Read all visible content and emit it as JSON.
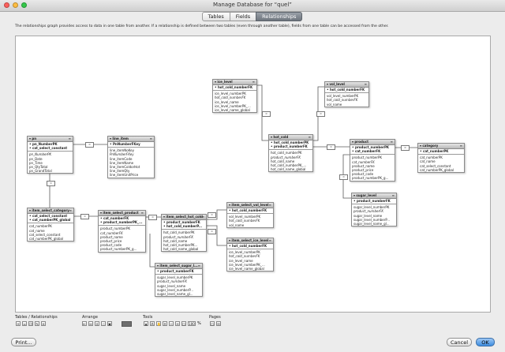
{
  "window": {
    "title": "Manage Database for “quel”"
  },
  "tabs": [
    {
      "label": "Tables"
    },
    {
      "label": "Fields"
    },
    {
      "label": "Relationships"
    }
  ],
  "description": "The relationships graph provides access to data in one table from another. If a relationship is defined between two tables (even through another table), fields from one table can be accessed from the other.",
  "tables": {
    "pn": {
      "name": "pn",
      "rows": [
        {
          "t": "pn_NumberPK",
          "c": "key"
        },
        {
          "t": "cat_select_constant",
          "c": "key"
        },
        {
          "sep": true
        },
        {
          "t": "pn_NumberPK",
          "c": "fk"
        },
        {
          "t": "pn_Date"
        },
        {
          "t": "pn_Time"
        },
        {
          "t": "pn_QtyTotal"
        },
        {
          "t": "pn_GrandTotal"
        }
      ]
    },
    "line_item": {
      "name": "line_item",
      "rows": [
        {
          "t": "PnNumberFKey",
          "c": "key"
        },
        {
          "sep": true
        },
        {
          "t": "line_itemNoKey"
        },
        {
          "t": "PnNumberFKey",
          "c": "fk"
        },
        {
          "t": "line_itemCode"
        },
        {
          "t": "line_itemName"
        },
        {
          "t": "line_itemColdorHot"
        },
        {
          "t": "line_itemQty"
        },
        {
          "t": "line_itemUnitPrice"
        }
      ]
    },
    "ice_level": {
      "name": "ice_level",
      "rows": [
        {
          "t": "hot_cold_numberFK",
          "c": "key"
        },
        {
          "sep": true
        },
        {
          "t": "ice_level_numberPK"
        },
        {
          "t": "hot_cold_numberFK",
          "c": "fk"
        },
        {
          "t": "ice_level_name"
        },
        {
          "t": "ice_level_numberPK_..."
        },
        {
          "t": "ice_level_name_global"
        }
      ]
    },
    "vol_level": {
      "name": "vol_level",
      "rows": [
        {
          "t": "hot_cold_numberFK",
          "c": "key"
        },
        {
          "sep": true
        },
        {
          "t": "vol_level_numberPK"
        },
        {
          "t": "hot_cold_numberFK",
          "c": "fk"
        },
        {
          "t": "vol_name"
        }
      ]
    },
    "hot_cold": {
      "name": "hot_cold",
      "rows": [
        {
          "t": "hot_cold_numberPK",
          "c": "key"
        },
        {
          "t": "product_numberFK",
          "c": "key"
        },
        {
          "sep": true
        },
        {
          "t": "hot_cold_numberPK"
        },
        {
          "t": "product_numberFK",
          "c": "fk"
        },
        {
          "t": "hot_cold_name"
        },
        {
          "t": "hot_cold_numberPK_..."
        },
        {
          "t": "hot_cold_name_global"
        }
      ]
    },
    "product": {
      "name": "product",
      "rows": [
        {
          "t": "product_numberPK",
          "c": "key"
        },
        {
          "t": "cat_numberFK",
          "c": "key"
        },
        {
          "sep": true
        },
        {
          "t": "product_numberPK"
        },
        {
          "t": "cat_numberFK",
          "c": "fk"
        },
        {
          "t": "product_name"
        },
        {
          "t": "product_price"
        },
        {
          "t": "product_code"
        },
        {
          "t": "product_numberPK_g..."
        }
      ]
    },
    "category": {
      "name": "category",
      "rows": [
        {
          "t": "cat_numberPK",
          "c": "key"
        },
        {
          "sep": true
        },
        {
          "t": "cat_numberPK"
        },
        {
          "t": "cat_name"
        },
        {
          "t": "cat_select_constant"
        },
        {
          "t": "cat_numberPK_global"
        }
      ]
    },
    "sugar_level": {
      "name": "sugar_level",
      "rows": [
        {
          "t": "product_numberFK",
          "c": "key"
        },
        {
          "sep": true
        },
        {
          "t": "sugar_level_numberPK"
        },
        {
          "t": "product_numberFK",
          "c": "fk"
        },
        {
          "t": "sugar_level_name"
        },
        {
          "t": "sugar_level_numberP..."
        },
        {
          "t": "sugar_level_name_gl..."
        }
      ]
    },
    "isc": {
      "name": "item_select_category",
      "rows": [
        {
          "t": "cat_select_constant",
          "c": "key"
        },
        {
          "t": "cat_numberPK_global",
          "c": "key"
        },
        {
          "sep": true
        },
        {
          "t": "cat_numberPK"
        },
        {
          "t": "cat_name"
        },
        {
          "t": "cat_select_constant"
        },
        {
          "t": "cat_numberPK_global"
        }
      ]
    },
    "isp": {
      "name": "item_select_product",
      "rows": [
        {
          "t": "cat_numberFK",
          "c": "key"
        },
        {
          "t": "product_numberPK_...",
          "c": "key"
        },
        {
          "sep": true
        },
        {
          "t": "product_numberPK"
        },
        {
          "t": "cat_numberFK",
          "c": "fk"
        },
        {
          "t": "product_name"
        },
        {
          "t": "product_price"
        },
        {
          "t": "product_code"
        },
        {
          "t": "product_numberPK_g..."
        }
      ]
    },
    "ishc": {
      "name": "item_select_hot_cold",
      "rows": [
        {
          "t": "product_numberFK",
          "c": "key"
        },
        {
          "t": "hot_cold_numberP...",
          "c": "key"
        },
        {
          "sep": true
        },
        {
          "t": "hot_cold_numberPK"
        },
        {
          "t": "product_numberFK",
          "c": "fk"
        },
        {
          "t": "hot_cold_name"
        },
        {
          "t": "hot_cold_numberPK..."
        },
        {
          "t": "hot_cold_name_global"
        }
      ]
    },
    "isvl": {
      "name": "item_select_vol_level",
      "rows": [
        {
          "t": "hot_cold_numberFK",
          "c": "key"
        },
        {
          "sep": true
        },
        {
          "t": "vol_level_numberPK"
        },
        {
          "t": "hot_cold_numberFK",
          "c": "fk"
        },
        {
          "t": "vol_name"
        }
      ]
    },
    "isil": {
      "name": "item_select_ice_level",
      "rows": [
        {
          "t": "hot_cold_numberFK",
          "c": "key"
        },
        {
          "sep": true
        },
        {
          "t": "ice_level_numberPK"
        },
        {
          "t": "hot_cold_numberFK",
          "c": "fk"
        },
        {
          "t": "ice_level_name"
        },
        {
          "t": "ice_level_numberPK_..."
        },
        {
          "t": "ice_level_name_global"
        }
      ]
    },
    "iss": {
      "name": "item_select_sugar_l...",
      "rows": [
        {
          "t": "product_numberFK",
          "c": "key"
        },
        {
          "sep": true
        },
        {
          "t": "sugar_level_numberPK"
        },
        {
          "t": "product_numberFK",
          "c": "fk"
        },
        {
          "t": "sugar_level_name"
        },
        {
          "t": "sugar_level_numberP..."
        },
        {
          "t": "sugar_level_name_gl..."
        }
      ]
    }
  },
  "relation_symbol": "=",
  "toolbar": {
    "tables_relationships_label": "Tables / Relationships",
    "arrange_label": "Arrange",
    "tools_label": "Tools",
    "pages_label": "Pages",
    "zoom_value": "100",
    "zoom_unit": "%"
  },
  "buttons": {
    "print": "Print...",
    "cancel": "Cancel",
    "ok": "OK"
  },
  "colors": {
    "window_bg": "#ececec",
    "canvas_bg": "#ffffff",
    "ok_button": "#3d8de0",
    "tab_active": "#7a8089"
  }
}
